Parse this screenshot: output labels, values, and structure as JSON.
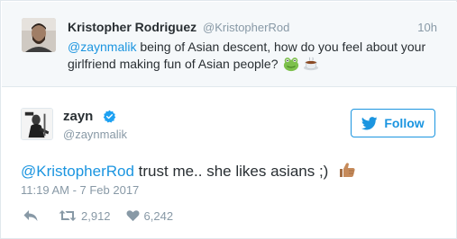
{
  "reply_tweet": {
    "author_name": "Kristopher Rodriguez",
    "author_handle": "@KristopherRod",
    "time_ago": "10h",
    "mention": "@zaynmalik",
    "text_line1": " being of Asian descent, how do you feel about your",
    "text_line2": "girlfriend making fun of Asian people?",
    "emojis": [
      "frog-face-icon",
      "hot-beverage-icon"
    ]
  },
  "main_tweet": {
    "author_name": "zayn",
    "author_handle": "@zaynmalik",
    "verified": true,
    "follow_label": "Follow",
    "mention": "@KristopherRod",
    "text": " trust me.. she likes asians ;)",
    "emoji": "thumbs-up-icon",
    "timestamp": "11:19 AM - 7 Feb 2017",
    "retweet_count": "2,912",
    "like_count": "6,242"
  },
  "colors": {
    "link": "#1b95e0",
    "meta": "#8899a6",
    "text": "#292f33",
    "reply_bg": "#f5f8fa",
    "border": "#e1e8ed"
  }
}
